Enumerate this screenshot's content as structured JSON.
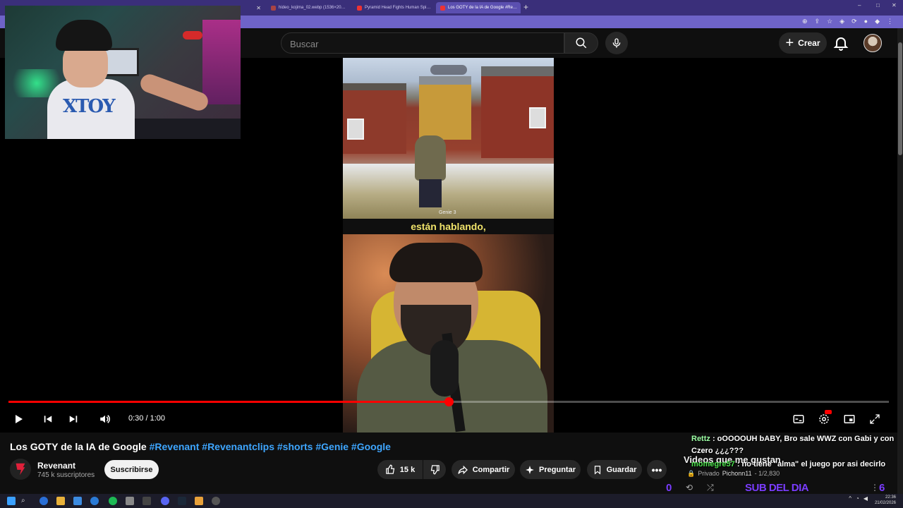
{
  "browser": {
    "tabs": [
      {
        "label": "",
        "active": false
      },
      {
        "label": "hideo_kojima_02.webp (1536×20…",
        "active": false
      },
      {
        "label": "Pyramid Head Fights Human Spi…",
        "active": false
      },
      {
        "label": "Los GOTY de la IA de Google #Re…",
        "active": true
      }
    ],
    "window_controls": [
      "–",
      "□",
      "✕"
    ]
  },
  "header": {
    "search_placeholder": "Buscar",
    "create_label": "Crear",
    "icons": [
      "search-icon",
      "mic-icon",
      "plus-icon",
      "bell-icon",
      "avatar"
    ]
  },
  "player": {
    "subtitle": "están hablando,",
    "watermark": "Genie 3",
    "time": "0:30 / 1:00",
    "progress": 0.5,
    "accent": "#ff0000"
  },
  "video": {
    "title": "Los GOTY de la IA de Google",
    "tags": "#Revenant #Revenantclips #shorts #Genie #Google",
    "channel": "Revenant",
    "subscribers": "745 k suscriptores",
    "subscribe_label": "Suscribirse",
    "likes": "15 k",
    "share_label": "Compartir",
    "ask_label": "Preguntar",
    "save_label": "Guardar"
  },
  "chat": {
    "msg1_user": "Rettz",
    "msg1_text": ": oOOOOUH bABY, Bro sale WWZ con Gabi y con",
    "msg1_cont": "Czero ¿¿¿???",
    "videos_like": "Videos que me gustan",
    "msg2_user": "momegre57",
    "msg2_text": ": no tiene \"alma\" el juego por asi decirlo",
    "privado": "Privado",
    "privado_user": "Pichonn11",
    "privado_count": "- 1/2,830",
    "left_num": "0",
    "sub_del_dia": "SUB DEL DIA",
    "right_num": "6",
    "overlay_color": "#7a3cff"
  },
  "taskbar": {
    "time": "22:36",
    "date": "21/02/2026"
  }
}
